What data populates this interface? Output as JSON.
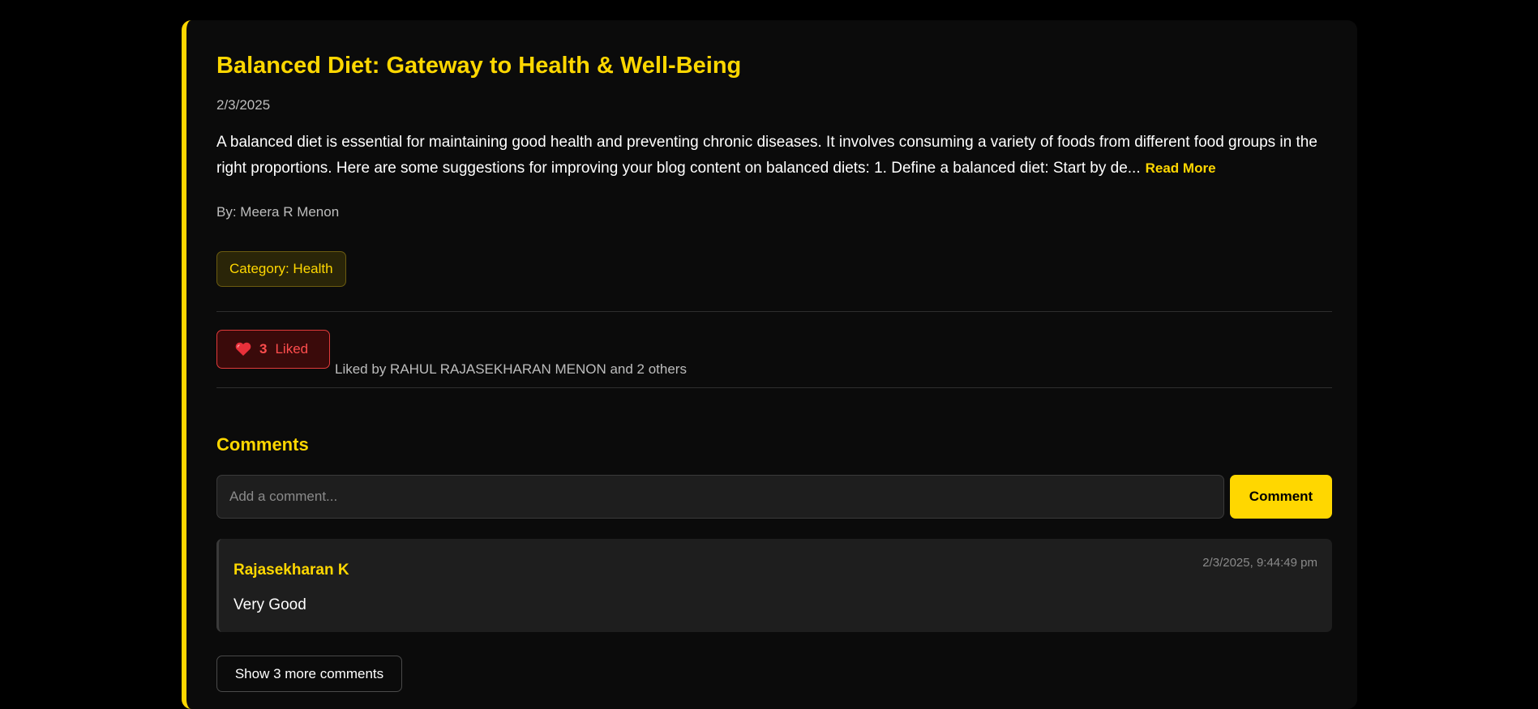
{
  "post": {
    "title": "Balanced Diet: Gateway to Health & Well-Being",
    "date": "2/3/2025",
    "excerpt": "A balanced diet is essential for maintaining good health and preventing chronic diseases. It involves consuming a variety of foods from different food groups in the right proportions. Here are some suggestions for improving your blog content on balanced diets: 1. Define a balanced diet: Start by de...",
    "read_more_label": "Read More",
    "author": "By: Meera R Menon",
    "category": "Category: Health"
  },
  "likes": {
    "icon": "heart-icon",
    "count": "3",
    "label": "Liked",
    "liked_by_text": "Liked by RAHUL RAJASEKHARAN MENON and 2 others"
  },
  "comments": {
    "heading": "Comments",
    "input_placeholder": "Add a comment...",
    "input_value": "",
    "submit_label": "Comment",
    "items": [
      {
        "author": "Rajasekharan K",
        "timestamp": "2/3/2025, 9:44:49 pm",
        "text": "Very Good"
      }
    ],
    "show_more_label": "Show 3 more comments"
  },
  "colors": {
    "accent": "#ffd700",
    "background": "#000000",
    "card": "#0b0b0b",
    "like": "#ff4d4d"
  }
}
